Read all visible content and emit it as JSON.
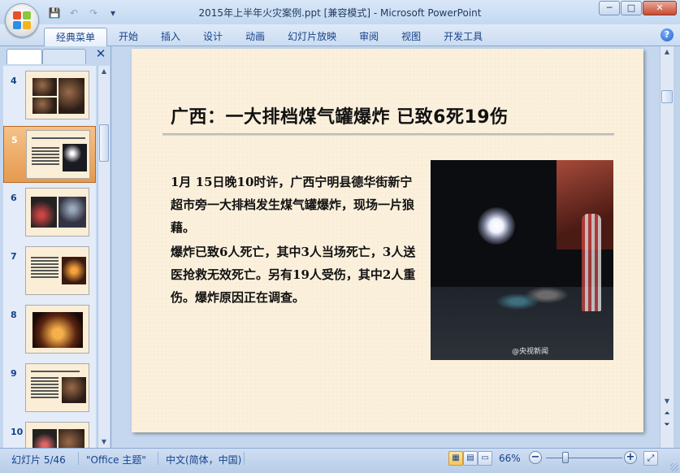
{
  "window": {
    "title": "2015年上半年火灾案例.ppt [兼容模式] - Microsoft PowerPoint",
    "controls": {
      "minimize": "─",
      "maximize": "□",
      "close": "✕"
    }
  },
  "quick_access": {
    "save": "💾",
    "undo": "↶",
    "redo": "↷",
    "more": "▾"
  },
  "ribbon": {
    "tabs": [
      {
        "label": "经典菜单",
        "active": true
      },
      {
        "label": "开始"
      },
      {
        "label": "插入"
      },
      {
        "label": "设计"
      },
      {
        "label": "动画"
      },
      {
        "label": "幻灯片放映"
      },
      {
        "label": "审阅"
      },
      {
        "label": "视图"
      },
      {
        "label": "开发工具"
      }
    ],
    "help": "?"
  },
  "left_panel": {
    "close": "✕",
    "thumbnails": [
      {
        "num": "4"
      },
      {
        "num": "5",
        "selected": true
      },
      {
        "num": "6"
      },
      {
        "num": "7"
      },
      {
        "num": "8"
      },
      {
        "num": "9"
      },
      {
        "num": "10"
      }
    ]
  },
  "slide": {
    "title": "广西：一大排档煤气罐爆炸  已致6死19伤",
    "body": [
      "1月 15日晚10时许，广西宁明县德华街新宁超市旁一大排档发生煤气罐爆炸，现场一片狼藉。",
      "爆炸已致6人死亡，其中3人当场死亡，3人送医抢救无效死亡。另有19人受伤，其中2人重伤。爆炸原因正在调查。"
    ],
    "photo_watermark": "@央视新闻"
  },
  "statusbar": {
    "slide_info": "幻灯片 5/46",
    "theme": "\"Office 主题\"",
    "language": "中文(简体，中国)",
    "zoom": "66%",
    "zoom_minus": "−",
    "zoom_plus": "+",
    "zoom_fraction": 0.26
  }
}
